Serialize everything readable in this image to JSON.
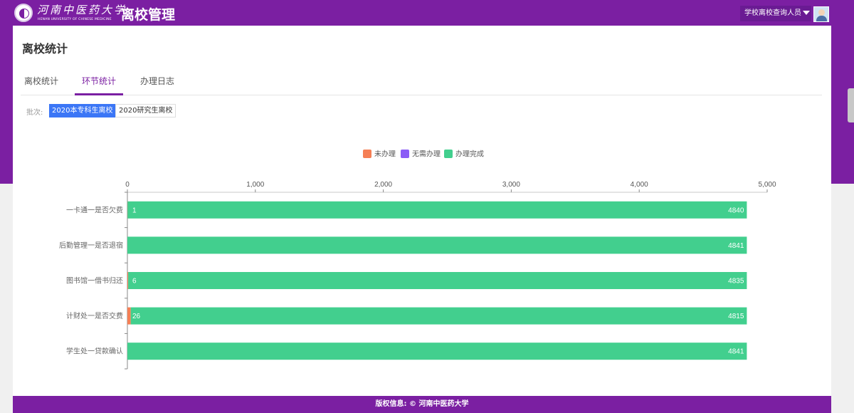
{
  "header": {
    "school_name": "河南中医药大学",
    "school_name_en": "HENAN UNIVERSITY OF CHINESE MEDICINE",
    "app_title": "离校管理",
    "user_role": "学校离校查询人员"
  },
  "page": {
    "title": "离校统计",
    "tabs": [
      {
        "label": "离校统计",
        "active": false
      },
      {
        "label": "环节统计",
        "active": true
      },
      {
        "label": "办理日志",
        "active": false
      }
    ],
    "batch_label": "批次:",
    "batches": [
      {
        "label": "2020本专科生离校",
        "active": true
      },
      {
        "label": "2020研究生离校",
        "active": false
      }
    ]
  },
  "chart_data": {
    "type": "bar",
    "orientation": "horizontal",
    "stacked": true,
    "categories": [
      "一卡通一是否欠费",
      "后勤管理一是否退宿",
      "图书馆一借书归还",
      "计财处一是否交费",
      "学生处一贷款确认"
    ],
    "series": [
      {
        "name": "未办理",
        "color": "#f57f55",
        "values": [
          1,
          0,
          6,
          26,
          0
        ]
      },
      {
        "name": "无需办理",
        "color": "#8b5cf6",
        "values": [
          0,
          0,
          0,
          0,
          0
        ]
      },
      {
        "name": "办理完成",
        "color": "#42cf8e",
        "values": [
          4840,
          4841,
          4835,
          4815,
          4841
        ]
      }
    ],
    "x_ticks": [
      "0",
      "1,000",
      "2,000",
      "3,000",
      "4,000",
      "5,000"
    ],
    "xlim": [
      0,
      5000
    ],
    "axis_position": "top",
    "legend_position": "top-center",
    "grid": false
  },
  "footer": {
    "copyright": "版权信息: © 河南中医药大学"
  },
  "colors": {
    "brand_purple": "#7b1fa2",
    "active_chip": "#3b76f6"
  }
}
